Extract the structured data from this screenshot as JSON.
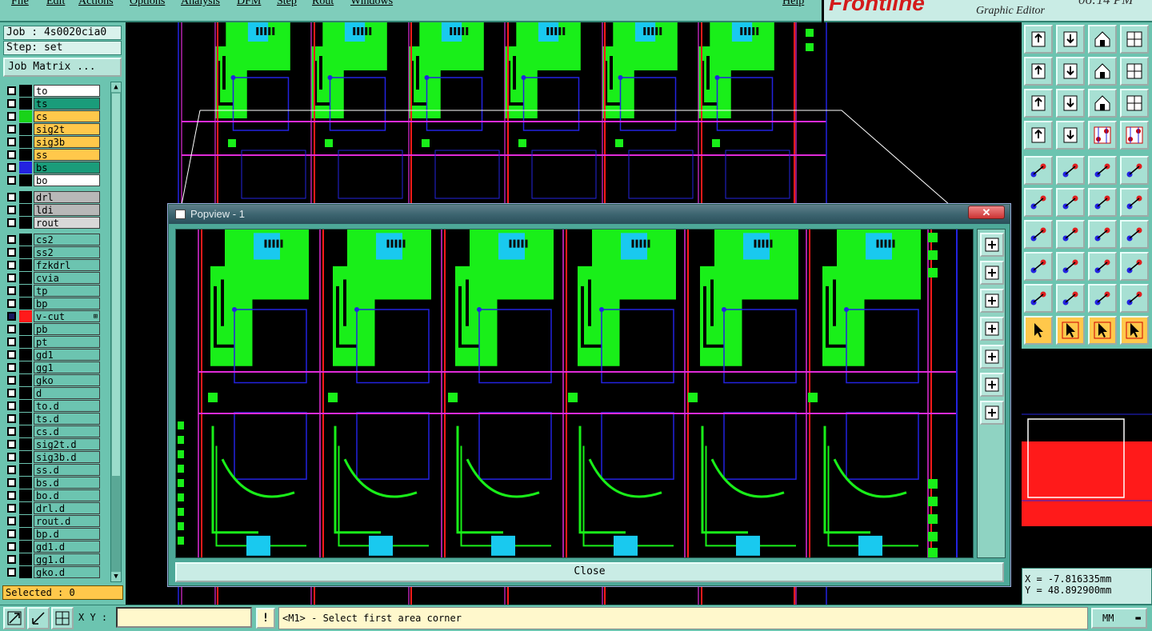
{
  "menu": {
    "items": [
      "File",
      "Edit",
      "Actions",
      "Options",
      "Analysis",
      "DFM",
      "Step",
      "Rout",
      "Windows"
    ],
    "help": "Help"
  },
  "brand": {
    "logo": "Frontline",
    "subtitle": "Graphic Editor",
    "clock": "06:14 PM"
  },
  "job": {
    "job_label": "Job : 4s0020cia0",
    "step_label": "Step: set",
    "matrix_button": "Job Matrix ..."
  },
  "layers": [
    {
      "name": "to",
      "swatch": "#000000",
      "bg": "#ffffff"
    },
    {
      "name": "ts",
      "swatch": "#000000",
      "bg": "#1a9c7a"
    },
    {
      "name": "cs",
      "swatch": "#19d319",
      "bg": "#ffc84b"
    },
    {
      "name": "sig2t",
      "swatch": "#000000",
      "bg": "#ffc84b"
    },
    {
      "name": "sig3b",
      "swatch": "#000000",
      "bg": "#ffc84b"
    },
    {
      "name": "ss",
      "swatch": "#000000",
      "bg": "#ffc84b"
    },
    {
      "name": "bs",
      "swatch": "#2323e0",
      "bg": "#1a9c7a"
    },
    {
      "name": "bo",
      "swatch": "#000000",
      "bg": "#ffffff"
    },
    {
      "name": "drl",
      "swatch": "#000000",
      "bg": "#b8b8b8"
    },
    {
      "name": "ldi",
      "swatch": "#000000",
      "bg": "#b8b8b8"
    },
    {
      "name": "rout",
      "swatch": "#000000",
      "bg": "#d8d8d8"
    },
    {
      "name": "cs2",
      "swatch": "#000000",
      "bg": "#6cc4b0"
    },
    {
      "name": "ss2",
      "swatch": "#000000",
      "bg": "#6cc4b0"
    },
    {
      "name": "fzkdrl",
      "swatch": "#000000",
      "bg": "#6cc4b0"
    },
    {
      "name": "cvia",
      "swatch": "#000000",
      "bg": "#6cc4b0"
    },
    {
      "name": "tp",
      "swatch": "#000000",
      "bg": "#6cc4b0"
    },
    {
      "name": "bp",
      "swatch": "#000000",
      "bg": "#6cc4b0"
    },
    {
      "name": "v-cut",
      "swatch": "#ff1a1a",
      "bg": "#6cc4b0",
      "plus": "⊞",
      "active": true
    },
    {
      "name": "pb",
      "swatch": "#000000",
      "bg": "#6cc4b0"
    },
    {
      "name": "pt",
      "swatch": "#000000",
      "bg": "#6cc4b0"
    },
    {
      "name": "gd1",
      "swatch": "#000000",
      "bg": "#6cc4b0"
    },
    {
      "name": "gg1",
      "swatch": "#000000",
      "bg": "#6cc4b0"
    },
    {
      "name": "gko",
      "swatch": "#000000",
      "bg": "#6cc4b0"
    },
    {
      "name": "d",
      "swatch": "#000000",
      "bg": "#6cc4b0"
    },
    {
      "name": "to.d",
      "swatch": "#000000",
      "bg": "#6cc4b0"
    },
    {
      "name": "ts.d",
      "swatch": "#000000",
      "bg": "#6cc4b0"
    },
    {
      "name": "cs.d",
      "swatch": "#000000",
      "bg": "#6cc4b0"
    },
    {
      "name": "sig2t.d",
      "swatch": "#000000",
      "bg": "#6cc4b0"
    },
    {
      "name": "sig3b.d",
      "swatch": "#000000",
      "bg": "#6cc4b0"
    },
    {
      "name": "ss.d",
      "swatch": "#000000",
      "bg": "#6cc4b0"
    },
    {
      "name": "bs.d",
      "swatch": "#000000",
      "bg": "#6cc4b0"
    },
    {
      "name": "bo.d",
      "swatch": "#000000",
      "bg": "#6cc4b0"
    },
    {
      "name": "drl.d",
      "swatch": "#000000",
      "bg": "#6cc4b0"
    },
    {
      "name": "rout.d",
      "swatch": "#000000",
      "bg": "#6cc4b0"
    },
    {
      "name": "bp.d",
      "swatch": "#000000",
      "bg": "#6cc4b0"
    },
    {
      "name": "gd1.d",
      "swatch": "#000000",
      "bg": "#6cc4b0"
    },
    {
      "name": "gg1.d",
      "swatch": "#000000",
      "bg": "#6cc4b0"
    },
    {
      "name": "gko.d",
      "swatch": "#000000",
      "bg": "#6cc4b0"
    }
  ],
  "selected_label": "Selected : 0",
  "toolbar_icons": [
    "upload-icon",
    "download-icon",
    "home-icon",
    "grid-icon",
    "align-left-icon",
    "align-right-icon",
    "swap-icon",
    "snake-icon",
    "fit-icon",
    "zoom-icon",
    "scale-icon",
    "help-icon",
    "settings-icon",
    "probe-icon",
    "layer-a-icon",
    "layer-b-icon",
    "feature-icon",
    "snap-icon",
    "ruler-icon",
    "pad-icon",
    "route-icon",
    "cross-icon",
    "measure-icon",
    "point-icon",
    "angle-icon",
    "line-icon",
    "rotate-icon",
    "text-icon",
    "pin-icon",
    "minus-icon",
    "center-icon",
    "group-icon",
    "triangle-icon",
    "peak-icon",
    "arrow-up-icon",
    "arrow-right-icon",
    "select-icon",
    "select-box-icon",
    "select-lasso-icon",
    "net-icon"
  ],
  "popview": {
    "title": "Popview - 1",
    "close_x": "✕",
    "close_button": "Close",
    "tools": [
      "fit-icon",
      "upload-icon",
      "download-icon",
      "left-icon",
      "right-icon",
      "zoom-icon",
      "pan-icon"
    ]
  },
  "coords": {
    "x": "X = -7.816335mm",
    "y": "Y = 48.892900mm"
  },
  "status": {
    "xy_label": "X Y :",
    "xy_value": "",
    "exclaim": "!",
    "prompt": "<M1> - Select first area corner",
    "units": "MM",
    "units_arrow": "▬"
  },
  "colors": {
    "panel": "#6cc4b0",
    "copper": "#19ef19",
    "outline": "#2323e0",
    "vcut": "#ff1a1a",
    "profile": "#e02bd8",
    "pad": "#19c9ef"
  }
}
